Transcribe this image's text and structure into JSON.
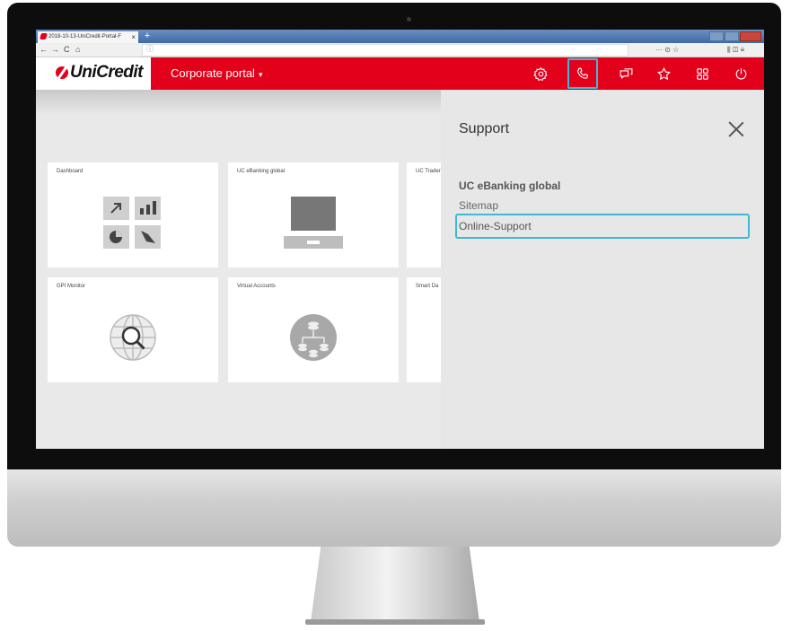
{
  "browser": {
    "tab_title": "2018-10-13-UniCredit-Portal-F",
    "new_tab_label": "+",
    "tab_close_label": "×",
    "back_label": "←",
    "forward_label": "→",
    "reload_label": "C",
    "home_label": "⌂",
    "info_label": "ⓘ",
    "right_controls_label": "··· ⊙ ☆",
    "far_right_controls_label": "⫼ ◫ ≡"
  },
  "app": {
    "logo_text": "UniCredit",
    "portal_menu_label": "Corporate portal",
    "portal_caret": "▾",
    "brand_color": "#e2001a",
    "highlight_color": "#3fb8d8",
    "header_icons": [
      "settings-icon",
      "phone-icon",
      "chat-icon",
      "star-icon",
      "apps-icon",
      "logout-icon"
    ]
  },
  "tiles": [
    {
      "title": "Dashboard",
      "icon": "dashboard-icon"
    },
    {
      "title": "UC eBanking global",
      "icon": "laptop-icon"
    },
    {
      "title": "UC Trader",
      "icon": "trader-icon"
    },
    {
      "title": "GPI Monitor",
      "icon": "globe-search-icon"
    },
    {
      "title": "Virtual Accounts",
      "icon": "accounts-tree-icon"
    },
    {
      "title": "Smart Da",
      "icon": "smart-data-icon"
    }
  ],
  "support_panel": {
    "title": "Support",
    "section": "UC eBanking global",
    "links": [
      "Sitemap",
      "Online-Support"
    ]
  }
}
